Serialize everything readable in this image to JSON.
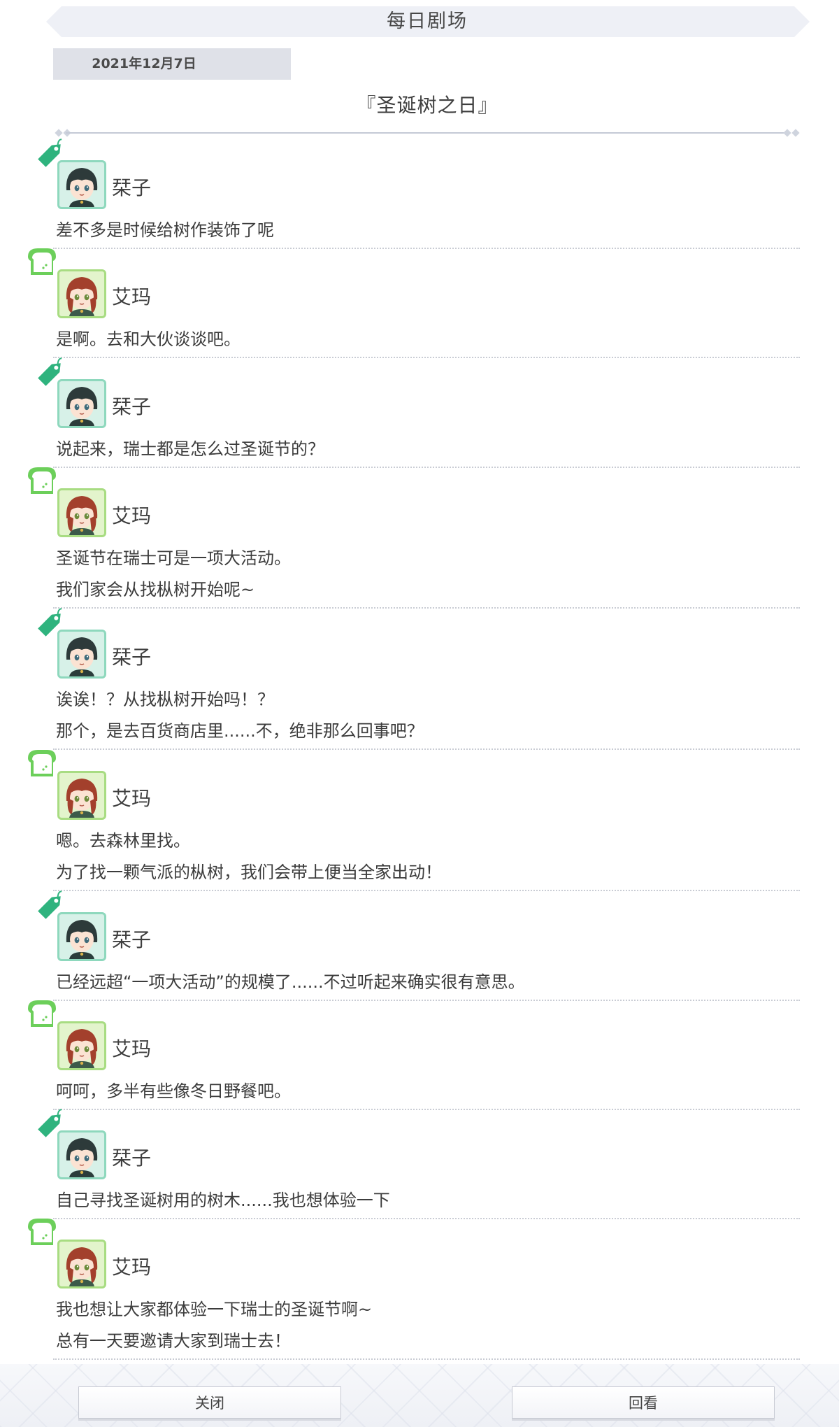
{
  "header": {
    "title": "每日剧场"
  },
  "date": "2021年12月7日",
  "episode_title": "『圣诞树之日』",
  "dialogue": [
    {
      "speaker": "栞子",
      "lines": [
        "差不多是时候给树作装饰了呢"
      ]
    },
    {
      "speaker": "艾玛",
      "lines": [
        "是啊。去和大伙谈谈吧。"
      ]
    },
    {
      "speaker": "栞子",
      "lines": [
        "说起来，瑞士都是怎么过圣诞节的？"
      ]
    },
    {
      "speaker": "艾玛",
      "lines": [
        "圣诞节在瑞士可是一项大活动。",
        "我们家会从找枞树开始呢~"
      ]
    },
    {
      "speaker": "栞子",
      "lines": [
        "诶诶！？从找枞树开始吗！？",
        "那个，是去百货商店里......不，绝非那么回事吧？"
      ]
    },
    {
      "speaker": "艾玛",
      "lines": [
        "嗯。去森林里找。",
        "为了找一颗气派的枞树，我们会带上便当全家出动！"
      ]
    },
    {
      "speaker": "栞子",
      "lines": [
        "已经远超“一项大活动”的规模了......不过听起来确实很有意思。"
      ]
    },
    {
      "speaker": "艾玛",
      "lines": [
        "呵呵，多半有些像冬日野餐吧。"
      ]
    },
    {
      "speaker": "栞子",
      "lines": [
        "自己寻找圣诞树用的树木......我也想体验一下"
      ]
    },
    {
      "speaker": "艾玛",
      "lines": [
        "我也想让大家都体验一下瑞士的圣诞节啊~",
        "总有一天要邀请大家到瑞士去！"
      ]
    }
  ],
  "buttons": {
    "close": "关闭",
    "review": "回看"
  },
  "colors": {
    "shioriko_tag": "#2fb37e",
    "emma_tag": "#6ccf5a",
    "shioriko_frame": "#8ed8bd",
    "emma_frame": "#a8dc82"
  },
  "icons": {
    "shioriko_tag": "tag-icon",
    "emma_tag": "bread-icon"
  }
}
